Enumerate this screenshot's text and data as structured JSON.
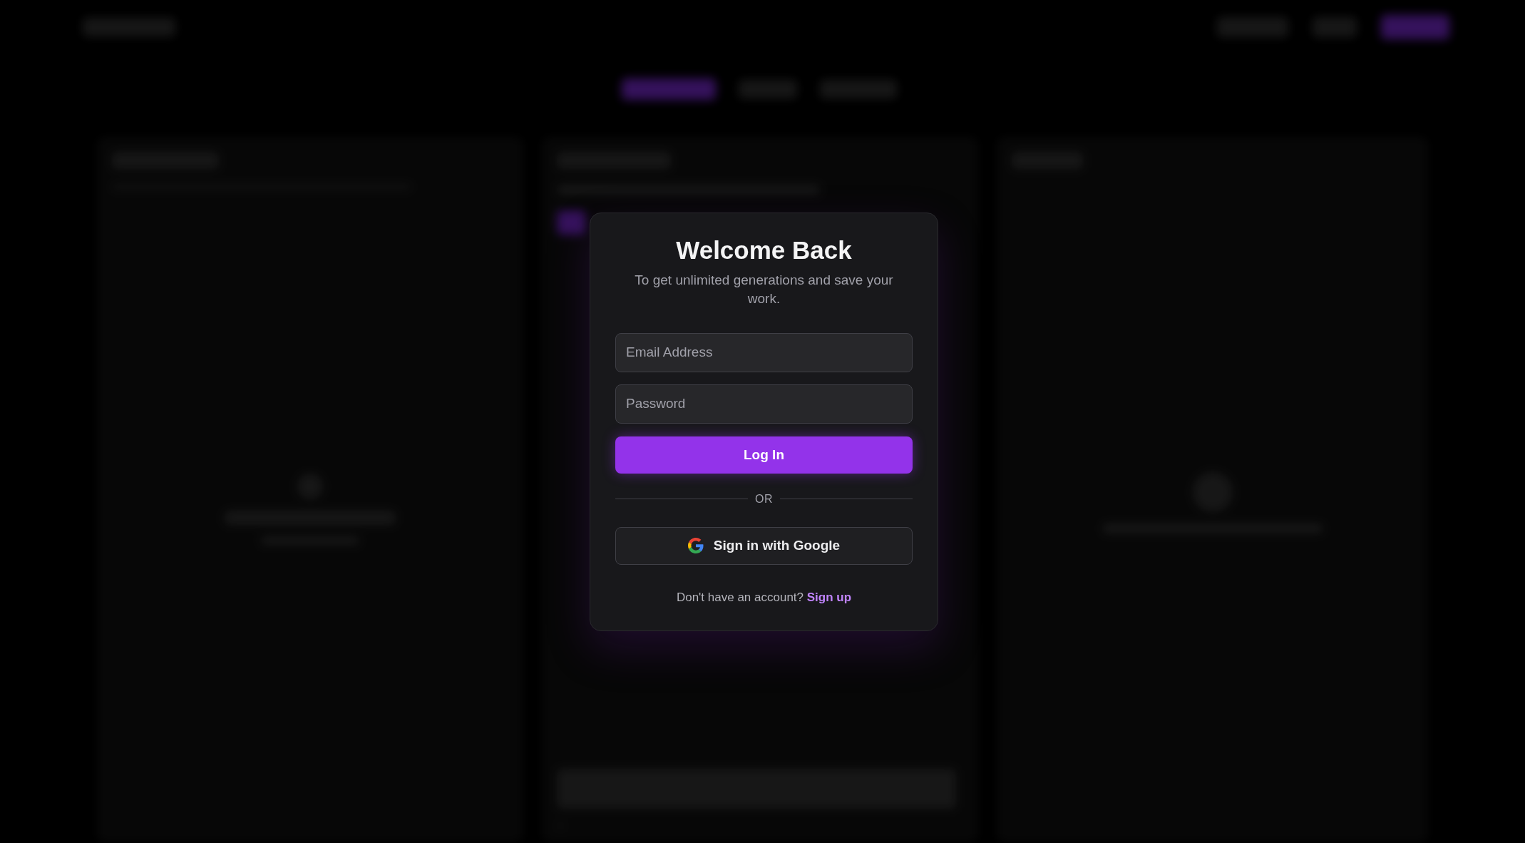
{
  "dialog": {
    "title": "Welcome Back",
    "subtitle": "To get unlimited generations and save your work.",
    "fields": [
      {
        "placeholder": "Email Address"
      },
      {
        "placeholder": "Password"
      }
    ],
    "submit_button": "Log In",
    "divider": "OR",
    "google_button": "Sign in with Google",
    "signup_prompt": {
      "text": "Don't have an account?",
      "link": "Sign up"
    }
  }
}
